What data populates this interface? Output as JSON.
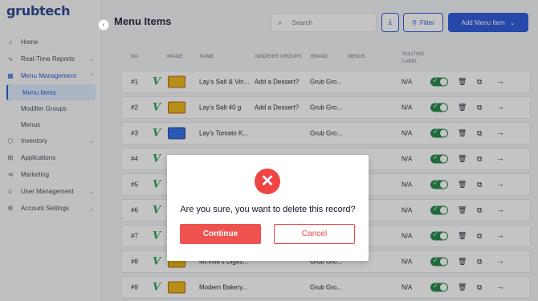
{
  "brand": "grubtech",
  "sidebar": {
    "collapse_icon": "‹",
    "items": [
      {
        "label": "Home",
        "icon": "home-icon",
        "glyph": "⌂"
      },
      {
        "label": "Real-Time Reports",
        "icon": "activity-icon",
        "glyph": "∿",
        "chevron": "⌄"
      },
      {
        "label": "Menu Management",
        "icon": "book-icon",
        "glyph": "▦",
        "chevron": "⌃",
        "active": true
      },
      {
        "label": "Inventory",
        "icon": "box-icon",
        "glyph": "⬡",
        "chevron": "⌄"
      },
      {
        "label": "Applications",
        "icon": "grid-icon",
        "glyph": "⊞"
      },
      {
        "label": "Marketing",
        "icon": "megaphone-icon",
        "glyph": "⊲"
      },
      {
        "label": "User Management",
        "icon": "users-icon",
        "glyph": "☺",
        "chevron": "⌄"
      },
      {
        "label": "Account Settings",
        "icon": "gear-icon",
        "glyph": "⚙",
        "chevron": "⌄"
      }
    ],
    "sub_items": [
      {
        "label": "Menu Items",
        "active": true
      },
      {
        "label": "Modifier Groups"
      },
      {
        "label": "Menus"
      }
    ]
  },
  "header": {
    "title": "Menu Items",
    "search_placeholder": "Search",
    "search_glyph": "⌕",
    "download_glyph": "⤓",
    "filter_label": "Filter",
    "filter_glyph": "⚲",
    "add_label": "Add Menu Item",
    "add_chevron": "⌄"
  },
  "table": {
    "columns": [
      "NO",
      "IMAGE",
      "NAME",
      "MODIFIER GROUPS",
      "BRAND",
      "MENUS",
      "ROUTING LABEL"
    ],
    "rows": [
      {
        "no": "#1",
        "name": "Lay's Salt & Vin...",
        "modifier": "Add a Dessert?",
        "brand": "Grub Gro...",
        "routing": "N/A",
        "thumb": "yellow"
      },
      {
        "no": "#2",
        "name": "Lay's Salt 40 g",
        "modifier": "Add a Dessert?",
        "brand": "Grub Gro...",
        "routing": "N/A",
        "thumb": "yellow"
      },
      {
        "no": "#3",
        "name": "Lay's Tomato K...",
        "modifier": "",
        "brand": "Grub Gro...",
        "routing": "N/A",
        "thumb": "blue"
      },
      {
        "no": "#4",
        "name": "",
        "modifier": "",
        "brand": "",
        "routing": "N/A",
        "thumb": ""
      },
      {
        "no": "#5",
        "name": "",
        "modifier": "",
        "brand": "",
        "routing": "N/A",
        "thumb": ""
      },
      {
        "no": "#6",
        "name": "",
        "modifier": "",
        "brand": "",
        "routing": "N/A",
        "thumb": ""
      },
      {
        "no": "#7",
        "name": "",
        "modifier": "",
        "brand": "",
        "routing": "N/A",
        "thumb": ""
      },
      {
        "no": "#8",
        "name": "McVitie's Diges...",
        "modifier": "",
        "brand": "Grub Gro...",
        "routing": "N/A",
        "thumb": "yellow"
      },
      {
        "no": "#9",
        "name": "Modern Bakery...",
        "modifier": "",
        "brand": "Grub Gro...",
        "routing": "N/A",
        "thumb": "yellow"
      }
    ],
    "veg_glyph": "V",
    "toggle_glyph": "✓",
    "delete_glyph": "🗑",
    "copy_glyph": "⧉",
    "open_glyph": "→"
  },
  "modal": {
    "icon_glyph": "✕",
    "message": "Are you sure, you want to delete this record?",
    "continue_label": "Continue",
    "cancel_label": "Cancel"
  }
}
